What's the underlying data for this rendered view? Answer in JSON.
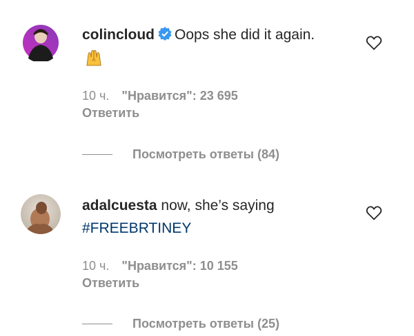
{
  "comments": [
    {
      "username": "colincloud",
      "text": "Oops she did it again.",
      "emoji": "raised-hands-emoji",
      "time": "10 ч.",
      "likes": "\"Нравится\": 23 695",
      "reply_label": "Ответить",
      "view_replies": "Посмотреть ответы (84)"
    },
    {
      "username": "adalcuesta",
      "text": "now, she’s saying",
      "hashtag": "#FREEBRTINEY",
      "time": "10 ч.",
      "likes": "\"Нравится\": 10 155",
      "reply_label": "Ответить",
      "view_replies": "Посмотреть ответы (25)"
    }
  ],
  "colors": {
    "link": "#00376b",
    "muted": "#8e8e8e",
    "verified": "#3897f0"
  },
  "icons": [
    "heart-icon",
    "verified-badge-icon"
  ]
}
